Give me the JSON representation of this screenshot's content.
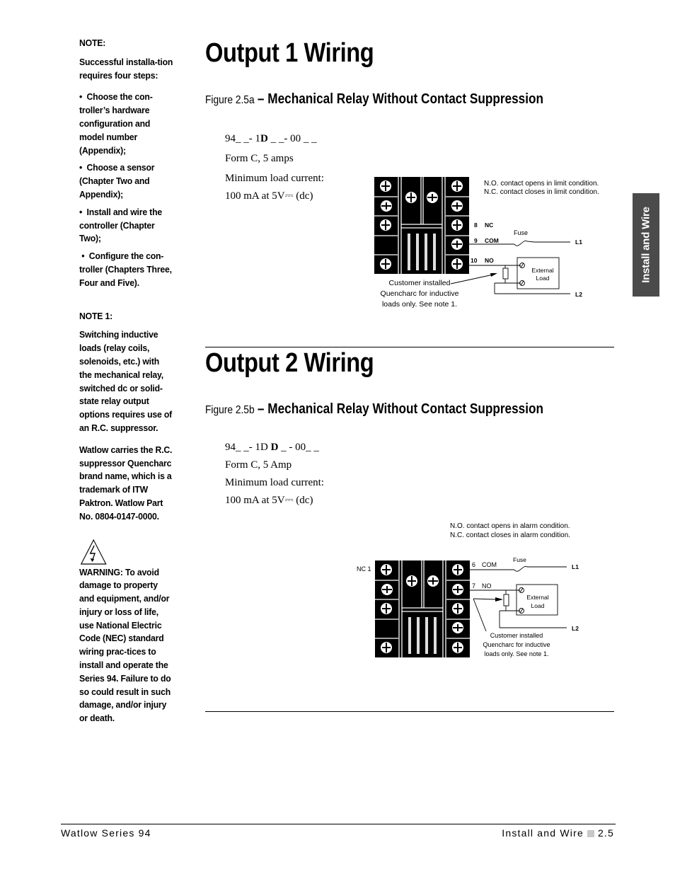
{
  "sidebar": {
    "note_heading": "NOTE:",
    "note_intro": "Successful installa-tion requires four steps:",
    "steps": [
      "Choose the con-troller’s hardware configuration and model number (Appendix);",
      "Choose a sensor (Chapter Two and Appendix);",
      "Install and wire the controller (Chapter Two);",
      "Configure the con-troller (Chapters Three, Four and Five)."
    ],
    "note1_heading": "NOTE 1:",
    "note1_text": "Switching inductive loads (relay coils, solenoids, etc.) with the mechanical relay, switched dc or solid-state relay output options requires use of an R.C. suppressor.",
    "watlow_text": "Watlow carries the R.C. suppressor Quencharc brand name, which is a trademark of ITW Paktron. Watlow Part No. 0804-0147-0000.",
    "warning_icon": "high-voltage-warning-icon",
    "warning_text": "WARNING: To avoid damage to property and equipment, and/or injury or loss of life, use National Electric Code (NEC) standard wiring prac-tices to install and operate the Series 94. Failure to do so could result in such damage, and/or injury or death."
  },
  "side_tab": {
    "label": "Install and Wire"
  },
  "section1": {
    "title": "Output 1 Wiring",
    "figure_number": "Figure 2.5a",
    "figure_title": "– Mechanical Relay Without Contact Suppression",
    "model_prefix": "94_ _- 1",
    "model_bold": "D",
    "model_suffix": " _ _- 00 _ _",
    "form": "Form C, 5 amps",
    "min_load_label": "Minimum load current:",
    "min_load_value": "100 mA at 5V⎓  (dc)",
    "diagram": {
      "note_line1": "N.O. contact opens in limit condition.",
      "note_line2": "N.C. contact closes in limit condition.",
      "terminals": [
        {
          "num": "8",
          "label": "NC"
        },
        {
          "num": "9",
          "label": "COM"
        },
        {
          "num": "10",
          "label": "NO"
        }
      ],
      "fuse_label": "Fuse",
      "l1_label": "L1",
      "l2_label": "L2",
      "load_line1": "External",
      "load_line2": "Load",
      "quencharc_line1": "Customer installed",
      "quencharc_line2": "Quencharc for inductive",
      "quencharc_line3": "loads only. See note 1."
    }
  },
  "section2": {
    "title": "Output 2 Wiring",
    "figure_number": "Figure 2.5b",
    "figure_title": "– Mechanical Relay Without Contact Suppression",
    "model_prefix": "94_ _- 1D ",
    "model_bold": "D",
    "model_suffix": " _ - 00_ _",
    "form": "Form C, 5 Amp",
    "min_load_label": "Minimum load current:",
    "min_load_value": "100 mA at 5V⎓ (dc)",
    "diagram": {
      "note_line1": "N.O. contact opens in alarm condition.",
      "note_line2": "N.C. contact closes in alarm condition.",
      "nc_label": "NC 1",
      "terminals": [
        {
          "num": "6",
          "label": "COM"
        },
        {
          "num": "7",
          "label": "NO"
        }
      ],
      "fuse_label": "Fuse",
      "l1_label": "L1",
      "l2_label": "L2",
      "load_line1": "External",
      "load_line2": "Load",
      "quencharc_line1": "Customer installed",
      "quencharc_line2": "Quencharc for inductive",
      "quencharc_line3": "loads only. See note 1."
    }
  },
  "footer": {
    "left": "Watlow Series 94",
    "right_section": "Install and Wire",
    "page": "2.5"
  }
}
